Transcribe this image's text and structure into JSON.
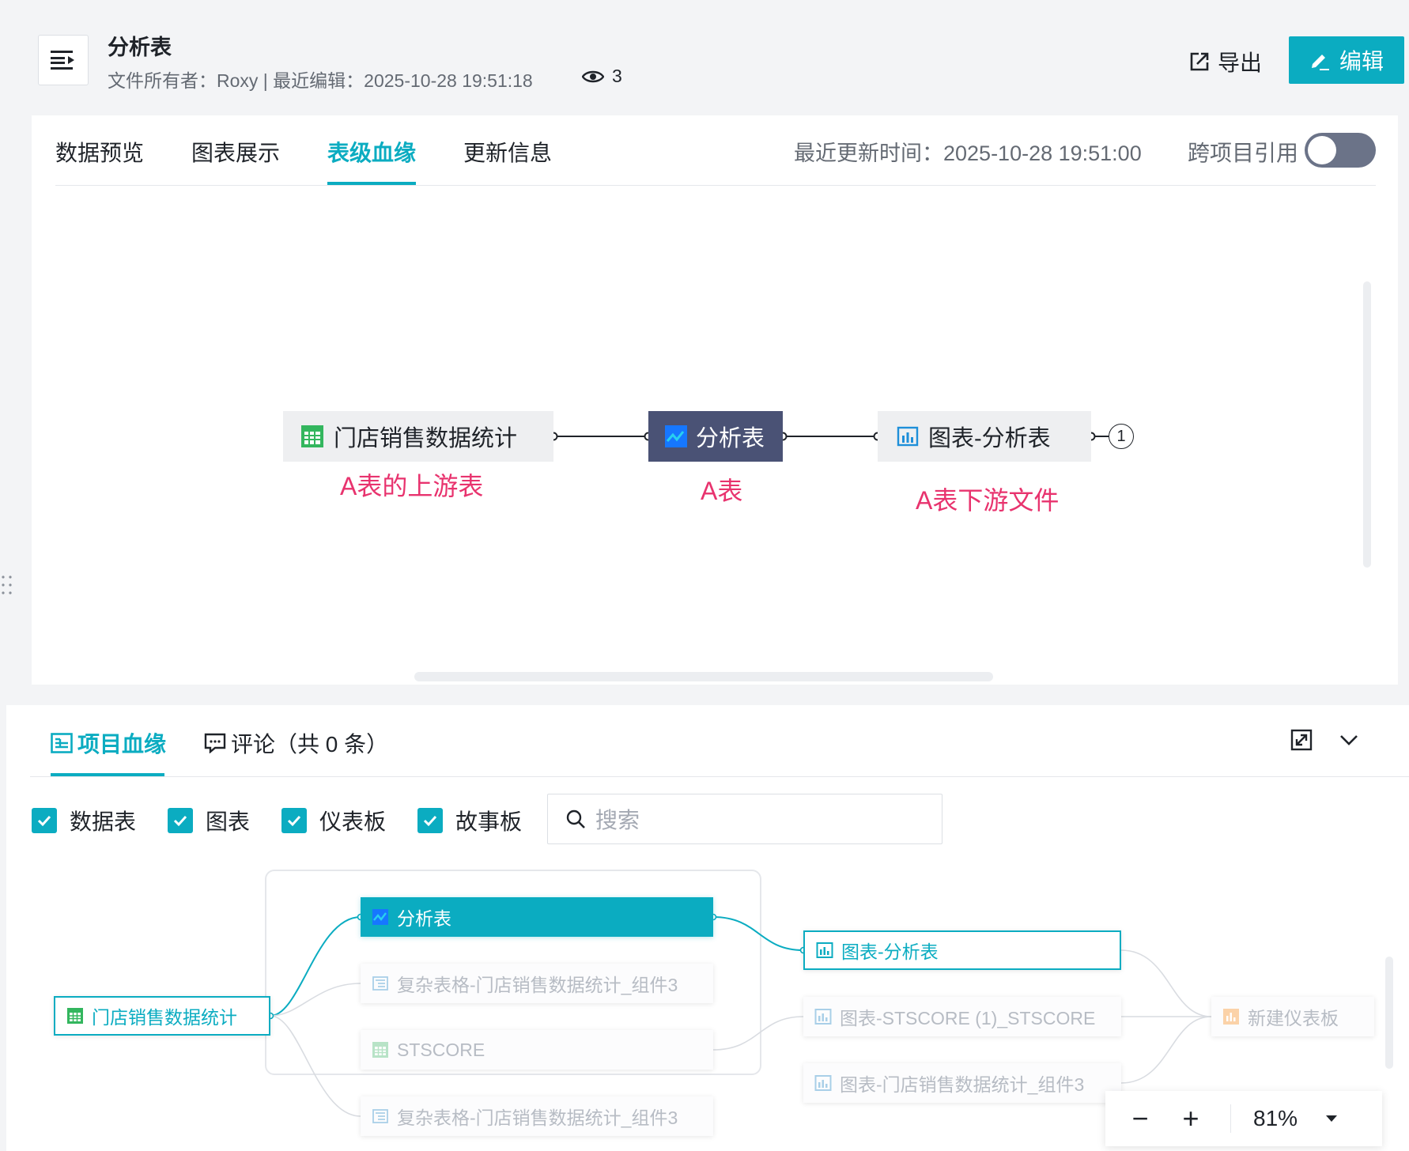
{
  "header": {
    "title": "分析表",
    "meta": "文件所有者：Roxy | 最近编辑：2025-10-28 19:51:18",
    "views": "3",
    "export_label": "导出",
    "edit_label": "编辑"
  },
  "top_tabs": {
    "items": [
      "数据预览",
      "图表展示",
      "表级血缘",
      "更新信息"
    ],
    "active": "表级血缘",
    "updated": "最近更新时间：2025-10-28 19:51:00",
    "cross_project": "跨项目引用",
    "cross_project_on": false
  },
  "lineage": {
    "upstream": "门店销售数据统计",
    "current": "分析表",
    "downstream": "图表-分析表",
    "downstream_count": "1",
    "annotations": [
      "A表的上游表",
      "A表",
      "A表下游文件"
    ]
  },
  "bottom_tabs": {
    "project_lineage": "项目血缘",
    "comments": "评论（共 0 条）"
  },
  "filters": {
    "items": [
      "数据表",
      "图表",
      "仪表板",
      "故事板"
    ],
    "checked": [
      true,
      true,
      true,
      true
    ],
    "search_placeholder": "搜索"
  },
  "project_nodes": {
    "source": "门店销售数据统计",
    "col2": [
      "分析表",
      "复杂表格-门店销售数据统计_组件3",
      "STSCORE",
      "复杂表格-门店销售数据统计_组件3"
    ],
    "col3": [
      "图表-分析表",
      "图表-STSCORE (1)_STSCORE",
      "图表-门店销售数据统计_组件3"
    ],
    "col4": "新建仪表板"
  },
  "zoom": {
    "minus": "−",
    "plus": "+",
    "level": "81%"
  },
  "colors": {
    "accent": "#0bacc1",
    "dark_node": "#4a5275",
    "annotation": "#e8336e"
  }
}
